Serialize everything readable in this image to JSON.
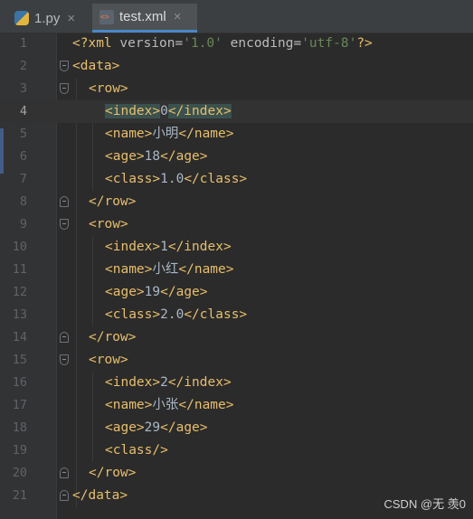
{
  "tabs": [
    {
      "label": "1.py",
      "close": "×"
    },
    {
      "label": "test.xml",
      "close": "×"
    }
  ],
  "line_numbers": [
    "1",
    "2",
    "3",
    "4",
    "5",
    "6",
    "7",
    "8",
    "9",
    "10",
    "11",
    "12",
    "13",
    "14",
    "15",
    "16",
    "17",
    "18",
    "19",
    "20",
    "21"
  ],
  "lines": {
    "l1": {
      "open": "<?xml ",
      "a1": "version",
      "eq1": "=",
      "v1": "'1.0'",
      "sp": " ",
      "a2": "encoding",
      "eq2": "=",
      "v2": "'utf-8'",
      "close": "?>"
    },
    "l2": {
      "tag": "<data>"
    },
    "l3": {
      "tag": "<row>"
    },
    "l4": {
      "open": "<index>",
      "text": "0",
      "close": "</index>"
    },
    "l5": {
      "open": "<name>",
      "text": "小明",
      "close": "</name>"
    },
    "l6": {
      "open": "<age>",
      "text": "18",
      "close": "</age>"
    },
    "l7": {
      "open": "<class>",
      "text": "1.0",
      "close": "</class>"
    },
    "l8": {
      "tag": "</row>"
    },
    "l9": {
      "tag": "<row>"
    },
    "l10": {
      "open": "<index>",
      "text": "1",
      "close": "</index>"
    },
    "l11": {
      "open": "<name>",
      "text": "小红",
      "close": "</name>"
    },
    "l12": {
      "open": "<age>",
      "text": "19",
      "close": "</age>"
    },
    "l13": {
      "open": "<class>",
      "text": "2.0",
      "close": "</class>"
    },
    "l14": {
      "tag": "</row>"
    },
    "l15": {
      "tag": "<row>"
    },
    "l16": {
      "open": "<index>",
      "text": "2",
      "close": "</index>"
    },
    "l17": {
      "open": "<name>",
      "text": "小张",
      "close": "</name>"
    },
    "l18": {
      "open": "<age>",
      "text": "29",
      "close": "</age>"
    },
    "l19": {
      "tag": "<class/>"
    },
    "l20": {
      "tag": "</row>"
    },
    "l21": {
      "tag": "</data>"
    }
  },
  "watermark": "CSDN @无 羡0",
  "colors": {
    "tag": "#e8bf6a",
    "text": "#a9b7c6",
    "value": "#6a8759",
    "background": "#2b2b2b"
  }
}
